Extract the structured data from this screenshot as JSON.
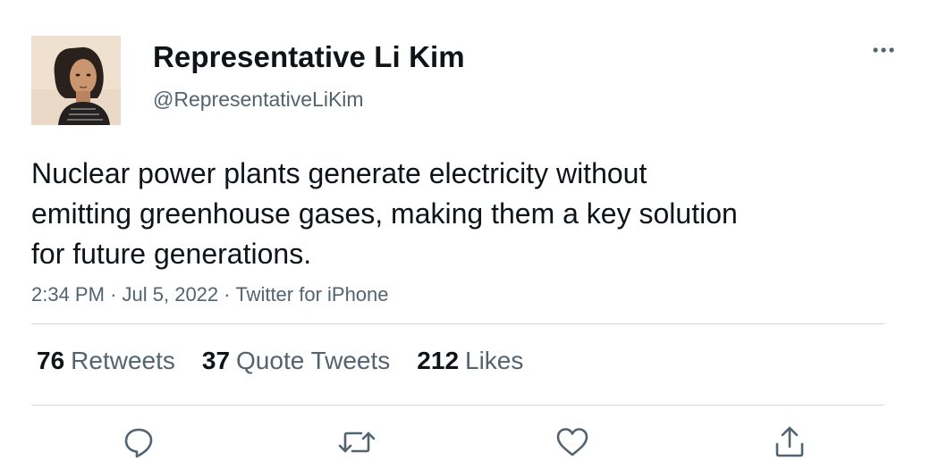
{
  "author": {
    "display_name": "Representative Li Kim",
    "handle": "@RepresentativeLiKim"
  },
  "tweet": {
    "text_lines": [
      "Nuclear power plants generate electricity without",
      "emitting greenhouse gases, making them a key solution",
      "for future generations."
    ],
    "time": "2:34 PM",
    "date": "Jul 5, 2022",
    "source": "Twitter for iPhone",
    "separator": "·"
  },
  "stats": {
    "retweets_count": "76",
    "retweets_label": "Retweets",
    "quotes_count": "37",
    "quotes_label": "Quote Tweets",
    "likes_count": "212",
    "likes_label": "Likes"
  },
  "icons": {
    "more": "more-horizontal-icon",
    "reply": "reply-icon",
    "retweet": "retweet-icon",
    "like": "heart-icon",
    "share": "share-icon"
  },
  "colors": {
    "text": "#0f1419",
    "secondary": "#536471",
    "divider": "#cfd9de"
  }
}
